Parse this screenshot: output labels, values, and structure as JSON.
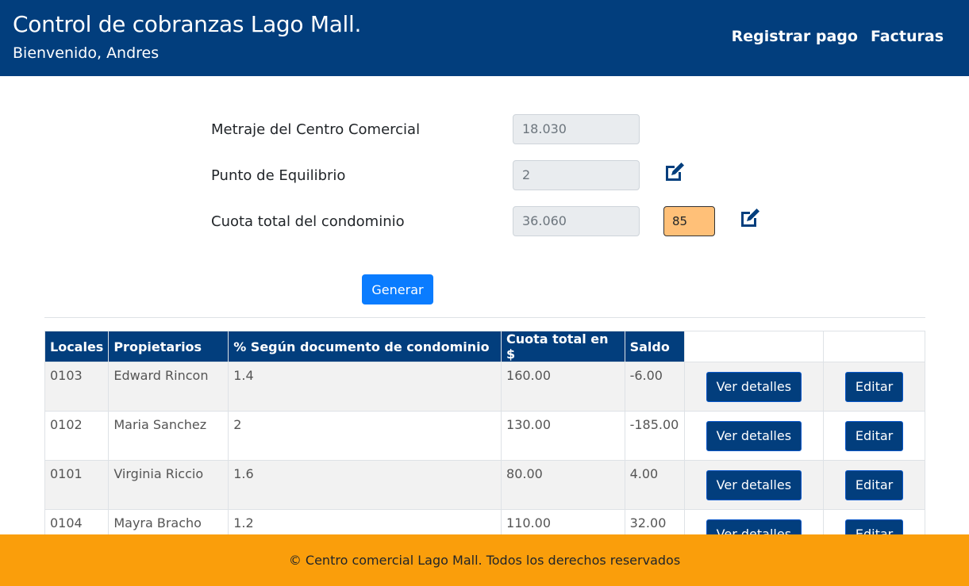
{
  "header": {
    "title": "Control de cobranzas Lago Mall.",
    "welcome": "Bienvenido, Andres",
    "nav": [
      "Registrar pago",
      "Facturas"
    ]
  },
  "form": {
    "metraje_label": "Metraje del Centro Comercial",
    "metraje_value": "18.030",
    "equilibrio_label": "Punto de Equilibrio",
    "equilibrio_value": "2",
    "cuota_label": "Cuota total del condominio",
    "cuota_value": "36.060",
    "cuota_extra_value": "85",
    "generate_label": "Generar"
  },
  "table": {
    "headers": [
      "Locales",
      "Propietarios",
      "% Según documento de condominio",
      "Cuota total en $",
      "Saldo"
    ],
    "rows": [
      {
        "local": "0103",
        "owner": "Edward Rincon",
        "percent": "1.4",
        "cuota": "160.00",
        "saldo": "-6.00"
      },
      {
        "local": "0102",
        "owner": "Maria Sanchez",
        "percent": "2",
        "cuota": "130.00",
        "saldo": "-185.00"
      },
      {
        "local": "0101",
        "owner": "Virginia Riccio",
        "percent": "1.6",
        "cuota": "80.00",
        "saldo": "4.00"
      },
      {
        "local": "0104",
        "owner": "Mayra Bracho",
        "percent": "1.2",
        "cuota": "110.00",
        "saldo": "32.00"
      }
    ],
    "details_label": "Ver detalles",
    "edit_label": "Editar"
  },
  "footer": {
    "text": "© Centro comercial Lago Mall. Todos los derechos reservados"
  },
  "colors": {
    "header_bg": "#023e7d",
    "footer_bg": "#fa9e0b",
    "primary_button": "#0a7cff",
    "highlight_input": "#ffc078"
  },
  "icons": {
    "edit": "pen-square-icon"
  }
}
